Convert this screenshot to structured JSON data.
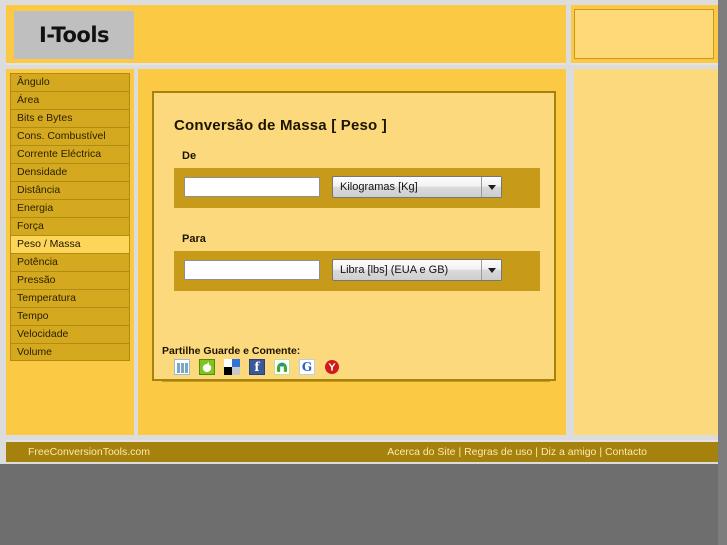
{
  "header": {
    "logo_text": "I-Tools",
    "ad_slot_label": ""
  },
  "sidebar": {
    "items": [
      {
        "label": "Ângulo",
        "active": false
      },
      {
        "label": "Área",
        "active": false
      },
      {
        "label": "Bits e Bytes",
        "active": false
      },
      {
        "label": "Cons. Combustível",
        "active": false
      },
      {
        "label": "Corrente Eléctrica",
        "active": false
      },
      {
        "label": "Densidade",
        "active": false
      },
      {
        "label": "Distância",
        "active": false
      },
      {
        "label": "Energia",
        "active": false
      },
      {
        "label": "Força",
        "active": false
      },
      {
        "label": "Peso / Massa",
        "active": true
      },
      {
        "label": "Potência",
        "active": false
      },
      {
        "label": "Pressão",
        "active": false
      },
      {
        "label": "Temperatura",
        "active": false
      },
      {
        "label": "Tempo",
        "active": false
      },
      {
        "label": "Velocidade",
        "active": false
      },
      {
        "label": "Volume",
        "active": false
      }
    ]
  },
  "converter": {
    "title": "Conversão de Massa [ Peso ]",
    "from": {
      "label": "De",
      "value": "",
      "placeholder": "",
      "unit": "Kilogramas [Kg]"
    },
    "to": {
      "label": "Para",
      "value": "",
      "placeholder": "",
      "unit": "Libra [lbs] (EUA e GB)"
    }
  },
  "share": {
    "label": "Partilhe Guarde e Comente:",
    "icons": [
      {
        "name": "mixx-icon",
        "title": "Mixx"
      },
      {
        "name": "technorati-icon",
        "title": "Technorati"
      },
      {
        "name": "delicious-icon",
        "title": "Delicious"
      },
      {
        "name": "facebook-icon",
        "title": "Facebook",
        "glyph": "f"
      },
      {
        "name": "stumbleupon-icon",
        "title": "StumbleUpon"
      },
      {
        "name": "google-icon",
        "title": "Google",
        "glyph": "G"
      },
      {
        "name": "yahoo-icon",
        "title": "Yahoo"
      }
    ]
  },
  "footer": {
    "site_name": "FreeConversionTools.com",
    "links": [
      "Acerca do Site",
      "Regras de uso",
      "Diz a amigo",
      "Contacto"
    ],
    "separator": " | "
  },
  "colors": {
    "brand_yellow": "#fbc943",
    "panel_yellow": "#fcd97c",
    "menu_gold": "#d4a81f",
    "menu_active": "#fdd558",
    "dark_gold": "#a5820e",
    "row_gold": "#c79a19",
    "footer_text": "#ffe9a8",
    "page_gray": "#6e6e6e"
  }
}
